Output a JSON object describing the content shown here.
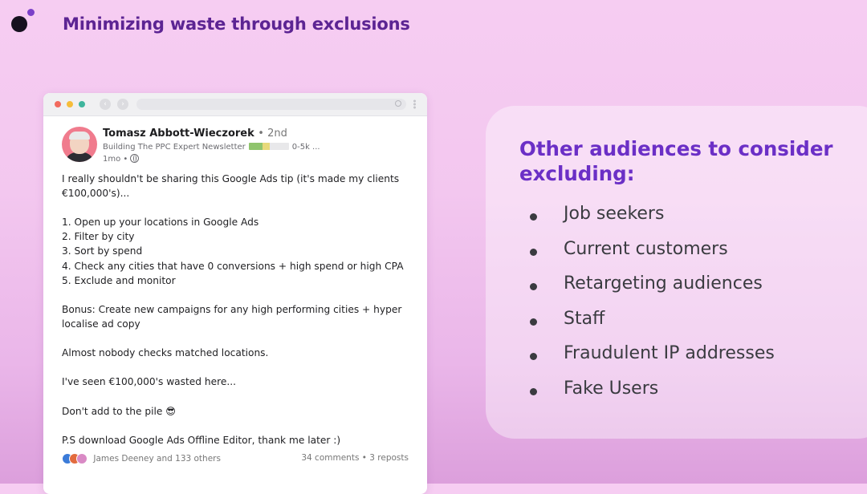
{
  "slide": {
    "title": "Minimizing waste through exclusions"
  },
  "post": {
    "author": "Tomasz Abbott-Wieczorek",
    "connection": "• 2nd",
    "headline_left": "Building The PPC Expert Newsletter",
    "headline_right": "0-5k ...",
    "time": "1mo •",
    "lines": [
      "I really shouldn't be sharing this Google Ads tip (it's made my clients",
      "€100,000's)...",
      "",
      "1. Open up your locations in Google Ads",
      "2. Filter by city",
      "3. Sort by spend",
      "4. Check any cities that have 0 conversions + high spend or high CPA",
      "5. Exclude and monitor",
      "",
      "Bonus: Create new campaigns for any high performing cities + hyper",
      "localise ad copy",
      "",
      "Almost nobody checks matched locations.",
      "",
      "I've seen €100,000's wasted here...",
      "",
      "Don't add to the pile 😎",
      "",
      "P.S download Google Ads Offline Editor, thank me later :)"
    ],
    "reactions_text": "James Deeney and 133 others",
    "comments_reposts": "34 comments • 3 reposts"
  },
  "panel": {
    "title": "Other audiences to consider excluding:",
    "items": [
      "Job seekers",
      "Current customers",
      "Retargeting audiences",
      "Staff",
      "Fraudulent IP addresses",
      "Fake Users"
    ]
  }
}
